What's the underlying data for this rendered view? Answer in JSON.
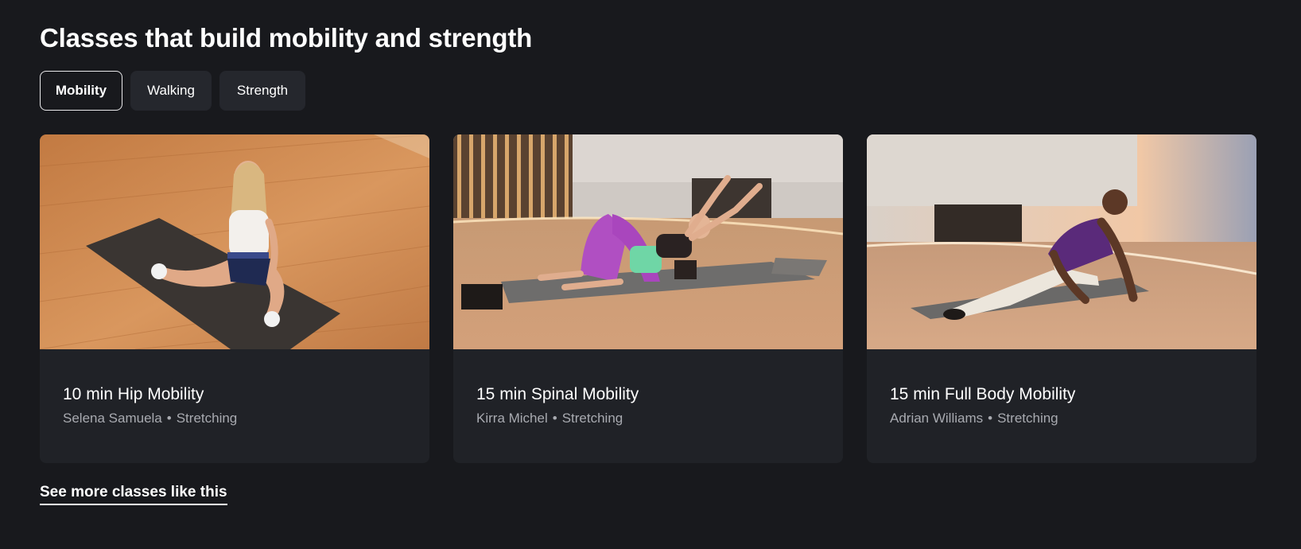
{
  "section": {
    "title": "Classes that build mobility and strength"
  },
  "tabs": [
    {
      "label": "Mobility",
      "active": true
    },
    {
      "label": "Walking",
      "active": false
    },
    {
      "label": "Strength",
      "active": false
    }
  ],
  "cards": [
    {
      "title": "10 min Hip Mobility",
      "instructor": "Selena Samuela",
      "separator": "•",
      "category": "Stretching",
      "thumbnail": "hip-mobility-class-thumbnail"
    },
    {
      "title": "15 min Spinal Mobility",
      "instructor": "Kirra Michel",
      "separator": "•",
      "category": "Stretching",
      "thumbnail": "spinal-mobility-class-thumbnail"
    },
    {
      "title": "15 min Full Body Mobility",
      "instructor": "Adrian Williams",
      "separator": "•",
      "category": "Stretching",
      "thumbnail": "full-body-mobility-class-thumbnail"
    }
  ],
  "footer": {
    "link_label": "See more classes like this"
  },
  "colors": {
    "background": "#18191d",
    "card": "#202227",
    "tab": "#25272d",
    "meta_text": "#a8aab0",
    "text": "#ffffff"
  }
}
